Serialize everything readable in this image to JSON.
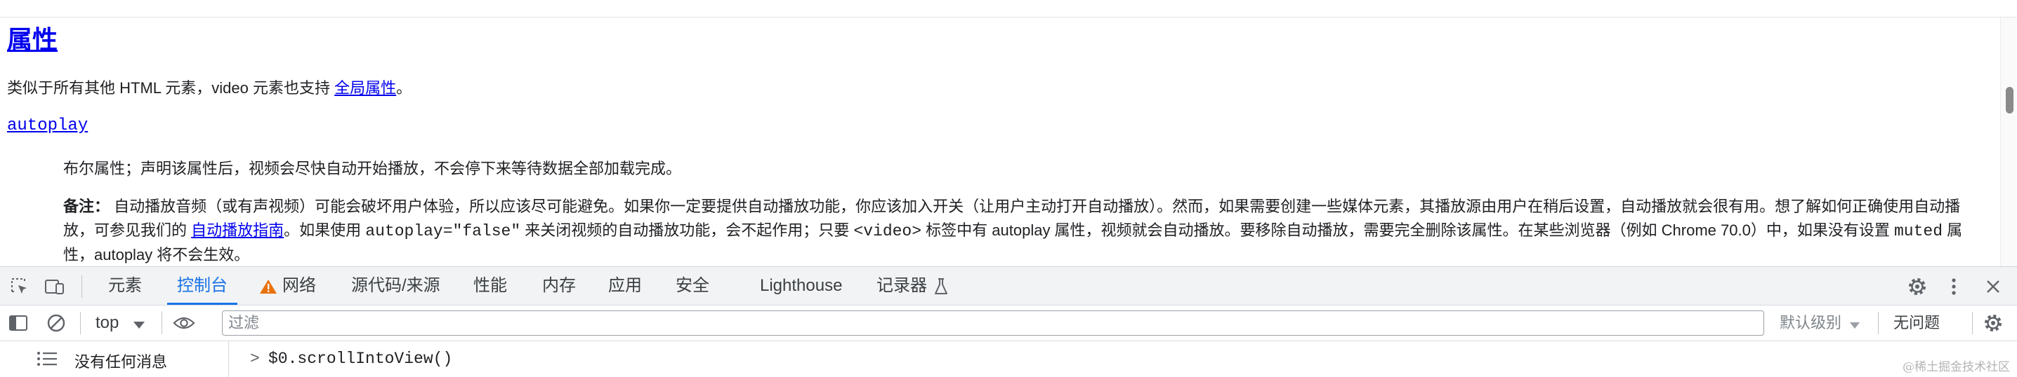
{
  "page": {
    "heading": "属性",
    "intro_text": "类似于所有其他 HTML 元素，video 元素也支持",
    "intro_link": "全局属性",
    "intro_end": "。",
    "term": "autoplay",
    "desc": "布尔属性；声明该属性后，视频会尽快自动开始播放，不会停下来等待数据全部加载完成。",
    "note": {
      "label": "备注：",
      "t1": "自动播放音频（或有声视频）可能会破坏用户体验，所以应该尽可能避免。如果你一定要提供自动播放功能，你应该加入开关（让用户主动打开自动播放）。然而，如果需要创建一些媒体元素，其播放源由用户在稍后设置，自动播放就会很有用。想了解如何正确使用自动播放，可参见我们的",
      "link": "自动播放指南",
      "t2": "。如果使用",
      "code1": "autoplay=\"false\"",
      "t3": "来关闭视频的自动播放功能，会不起作用；只要",
      "code2": "<video>",
      "t4": "标签中有 autoplay 属性，视频就会自动播放。要移除自动播放，需要完全删除该属性。在某些浏览器（例如 Chrome 70.0）中，如果没有设置",
      "code3": "muted",
      "t5": "属性，autoplay 将不会生效。"
    }
  },
  "devtools": {
    "tabs": [
      {
        "label": "元素"
      },
      {
        "label": "控制台"
      },
      {
        "label": "网络"
      },
      {
        "label": "源代码/来源"
      },
      {
        "label": "性能"
      },
      {
        "label": "内存"
      },
      {
        "label": "应用"
      },
      {
        "label": "安全"
      },
      {
        "label": "Lighthouse"
      },
      {
        "label": "记录器"
      }
    ],
    "active_tab": "控制台",
    "toolbar": {
      "context": "top",
      "filter_placeholder": "过滤",
      "levels": "默认级别",
      "issues": "无问题"
    },
    "sidebar_label": "没有任何消息",
    "prompt": ">",
    "command": "$0.scrollIntoView()"
  },
  "watermark": "@稀土掘金技术社区",
  "colors": {
    "accent": "#1a73e8",
    "link": "#0000ee",
    "warning": "#e8710a",
    "toolbar_bg": "#f1f3f4"
  },
  "icons": [
    "inspect-element-icon",
    "device-toggle-icon",
    "warning-icon",
    "flask-icon",
    "settings-icon",
    "more-vertical-icon",
    "close-icon",
    "sidebar-toggle-icon",
    "clear-console-icon",
    "dropdown-arrow-icon",
    "eye-icon",
    "console-settings-icon",
    "list-icon"
  ]
}
